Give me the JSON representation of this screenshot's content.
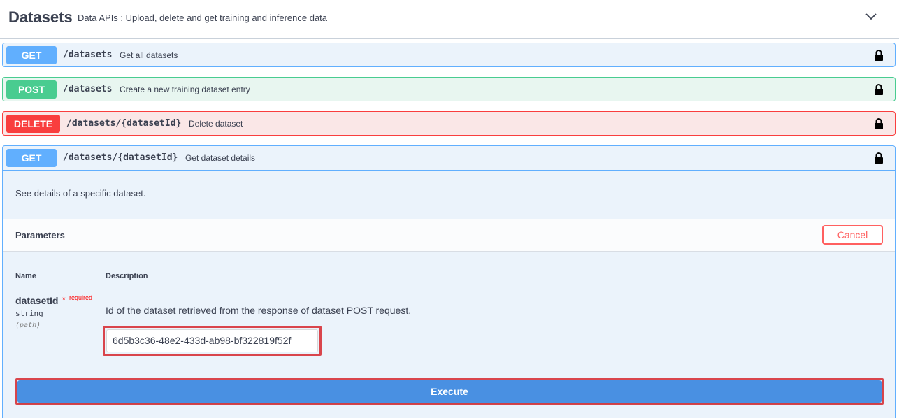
{
  "header": {
    "title": "Datasets",
    "subtitle": "Data APIs : Upload, delete and get training and inference data",
    "toggle_icon": "chevron-down-icon"
  },
  "operations": [
    {
      "method": "GET",
      "path": "/datasets",
      "description": "Get all datasets",
      "color": "#61affe"
    },
    {
      "method": "POST",
      "path": "/datasets",
      "description": "Create a new training dataset entry",
      "color": "#49cc90"
    },
    {
      "method": "DELETE",
      "path": "/datasets/{datasetId}",
      "description": "Delete dataset",
      "color": "#f93e3e"
    },
    {
      "method": "GET",
      "path": "/datasets/{datasetId}",
      "description": "Get dataset details",
      "color": "#61affe"
    }
  ],
  "expanded": {
    "description": "See details of a specific dataset.",
    "parameters_title": "Parameters",
    "cancel_label": "Cancel",
    "columns": {
      "name": "Name",
      "description": "Description"
    },
    "parameter": {
      "name": "datasetId",
      "required_star": "*",
      "required_label": "required",
      "type": "string",
      "location": "(path)",
      "description": "Id of the dataset retrieved from the response of dataset POST request.",
      "value": "6d5b3c36-48e2-433d-ab98-bf322819f52f"
    },
    "execute_label": "Execute"
  },
  "colors": {
    "execute": "#4990e2",
    "cancel": "#ff6060",
    "highlight": "#d9454c"
  }
}
